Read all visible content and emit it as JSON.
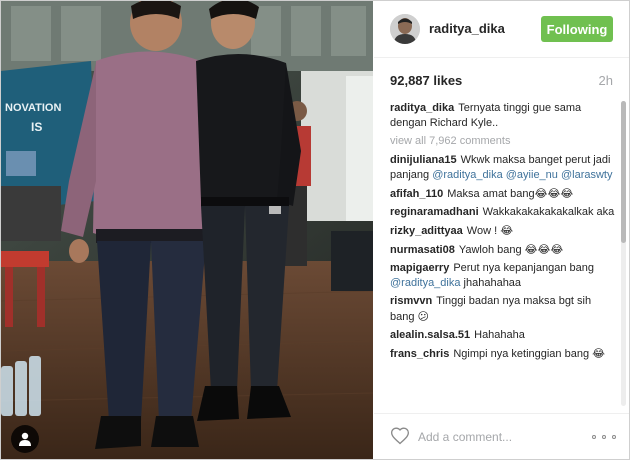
{
  "post": {
    "username": "raditya_dika",
    "follow_label": "Following",
    "likes": "92,887 likes",
    "age": "2h",
    "caption": {
      "author": "raditya_dika",
      "text": "Ternyata tinggi gue sama dengan Richard Kyle.."
    },
    "view_all": "view all 7,962 comments",
    "comments": [
      {
        "author": "dinijuliana15",
        "parts": [
          {
            "t": "Wkwk maksa banget perut jadi panjang "
          },
          {
            "t": "@raditya_dika",
            "m": true
          },
          {
            "t": " "
          },
          {
            "t": "@ayiie_nu",
            "m": true
          },
          {
            "t": " "
          },
          {
            "t": "@laraswty",
            "m": true
          }
        ]
      },
      {
        "author": "afifah_110",
        "parts": [
          {
            "t": "Maksa amat bang"
          },
          {
            "e": "😂😂😂"
          }
        ]
      },
      {
        "author": "reginaramadhani",
        "parts": [
          {
            "t": "Wakkakakakakakalkak aka"
          }
        ]
      },
      {
        "author": "rizky_adittyaa",
        "parts": [
          {
            "t": "Wow ! "
          },
          {
            "e": "😂"
          }
        ]
      },
      {
        "author": "nurmasati08",
        "parts": [
          {
            "t": "Yawloh bang "
          },
          {
            "e": "😂😂😂"
          }
        ]
      },
      {
        "author": "mapigaerry",
        "parts": [
          {
            "t": "Perut nya kepanjangan bang "
          },
          {
            "t": "@raditya_dika",
            "m": true
          },
          {
            "t": " jhahahahaa"
          }
        ]
      },
      {
        "author": "rismvvn",
        "parts": [
          {
            "t": "Tinggi badan nya maksa bgt sih bang "
          },
          {
            "e": "😕"
          }
        ]
      },
      {
        "author": "alealin.salsa.51",
        "parts": [
          {
            "t": "Hahahaha"
          }
        ]
      },
      {
        "author": "frans_chris",
        "parts": [
          {
            "t": "Ngimpi nya ketinggian bang "
          },
          {
            "e": "😂"
          }
        ]
      }
    ],
    "add_comment_placeholder": "Add a comment..."
  },
  "photo": {
    "sign_text_line1": "NOVATION",
    "sign_text_line2": "IS"
  },
  "icons": {
    "heart": "heart-icon",
    "more": "more-options-icon",
    "user_tag": "user-tag-icon"
  },
  "colors": {
    "follow_button": "#70c050",
    "mention": "#3f729b",
    "muted": "#a5a7aa",
    "text": "#262626"
  }
}
